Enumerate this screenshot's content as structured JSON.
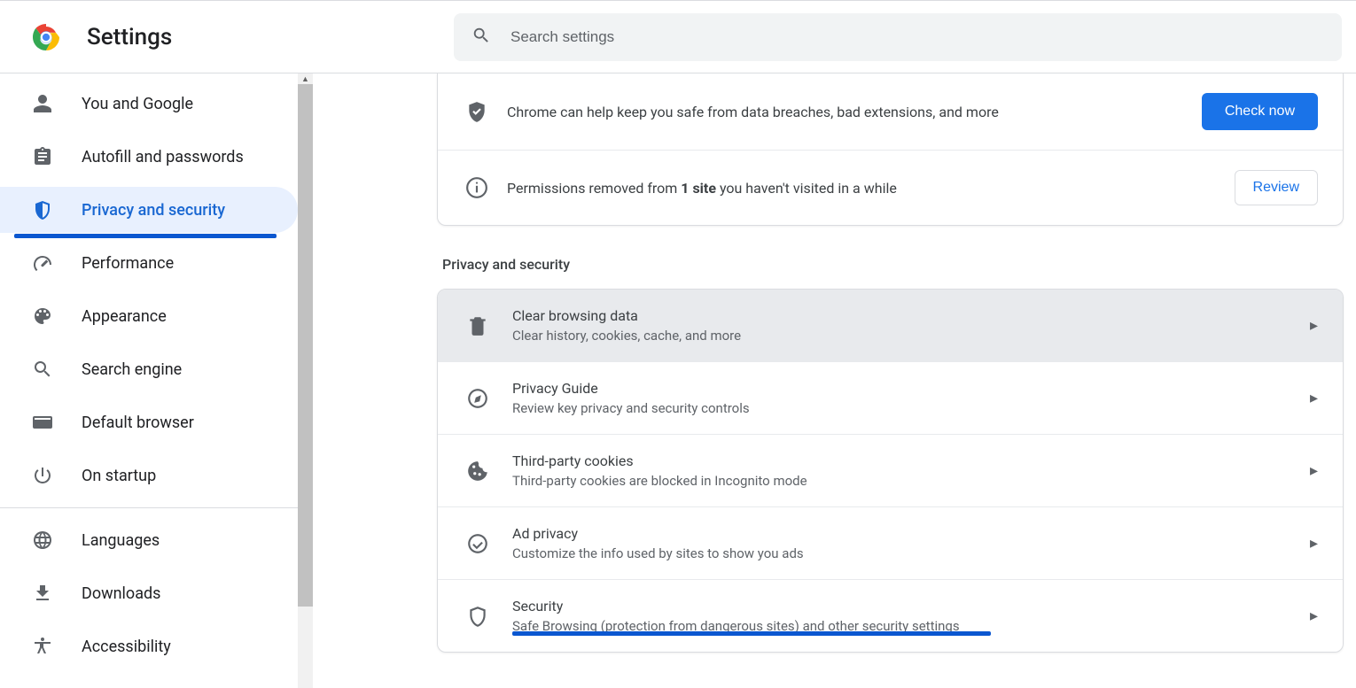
{
  "header": {
    "title": "Settings",
    "search_placeholder": "Search settings"
  },
  "sidebar": {
    "items": [
      {
        "label": "You and Google"
      },
      {
        "label": "Autofill and passwords"
      },
      {
        "label": "Privacy and security"
      },
      {
        "label": "Performance"
      },
      {
        "label": "Appearance"
      },
      {
        "label": "Search engine"
      },
      {
        "label": "Default browser"
      },
      {
        "label": "On startup"
      },
      {
        "label": "Languages"
      },
      {
        "label": "Downloads"
      },
      {
        "label": "Accessibility"
      }
    ]
  },
  "safety": {
    "row1_prefix": "Chrome can help keep you safe from data breaches, bad extensions, and more",
    "row1_button": "Check now",
    "row2_prefix": "Permissions removed from ",
    "row2_bold": "1 site",
    "row2_suffix": " you haven't visited in a while",
    "row2_button": "Review"
  },
  "section_title": "Privacy and security",
  "settings_rows": [
    {
      "title": "Clear browsing data",
      "sub": "Clear history, cookies, cache, and more"
    },
    {
      "title": "Privacy Guide",
      "sub": "Review key privacy and security controls"
    },
    {
      "title": "Third-party cookies",
      "sub": "Third-party cookies are blocked in Incognito mode"
    },
    {
      "title": "Ad privacy",
      "sub": "Customize the info used by sites to show you ads"
    },
    {
      "title": "Security",
      "sub": "Safe Browsing (protection from dangerous sites) and other security settings"
    }
  ]
}
